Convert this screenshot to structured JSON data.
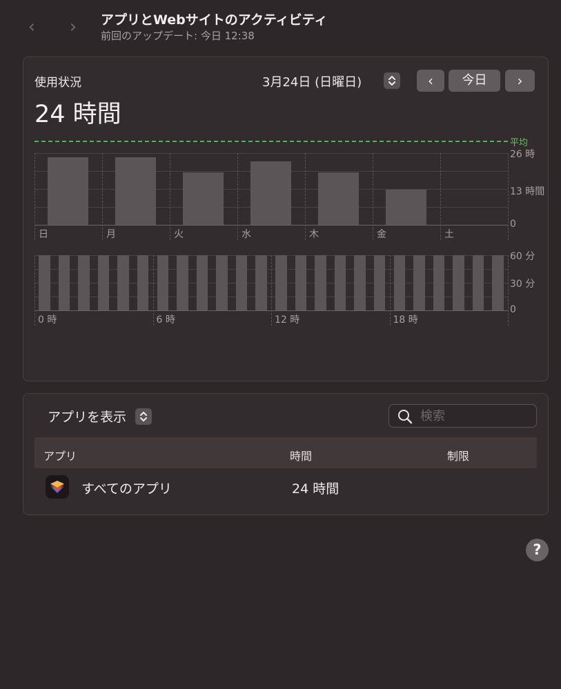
{
  "header": {
    "title": "アプリとWebサイトのアクティビティ",
    "subtitle": "前回のアップデート: 今日 12:38",
    "back_glyph": "‹",
    "forward_glyph": "›"
  },
  "usage": {
    "label": "使用状況",
    "total": "24 時間",
    "date": "3月24日 (日曜日)",
    "prev_glyph": "‹",
    "today_label": "今日",
    "next_glyph": "›"
  },
  "chart_data": [
    {
      "type": "bar",
      "categories": [
        "日",
        "月",
        "火",
        "水",
        "木",
        "金",
        "土"
      ],
      "values": [
        24.5,
        24.5,
        19.0,
        23.0,
        19.0,
        12.8,
        0
      ],
      "y_ticks": [
        "26 時",
        "13 時間",
        "0"
      ],
      "average_label": "平均",
      "average_value": 30,
      "ylim": [
        0,
        26
      ],
      "grid": true
    },
    {
      "type": "bar",
      "x_ticks": [
        "0 時",
        "6 時",
        "12 時",
        "18 時"
      ],
      "y_ticks": [
        "60 分",
        "30 分",
        "0"
      ],
      "ylim": [
        0,
        60
      ],
      "hours": 24,
      "bars_per_hour": 1,
      "values": [
        60,
        60,
        60,
        60,
        60,
        60,
        60,
        60,
        60,
        60,
        60,
        60,
        60,
        60,
        60,
        60,
        60,
        60,
        60,
        60,
        60,
        60,
        60,
        60
      ],
      "grid": true
    }
  ],
  "apps": {
    "show_label": "アプリを表示",
    "search_placeholder": "検索",
    "columns": [
      "アプリ",
      "時間",
      "制限"
    ],
    "rows": [
      {
        "name": "すべてのアプリ",
        "time": "24 時間",
        "limit": ""
      }
    ]
  },
  "help": "?"
}
